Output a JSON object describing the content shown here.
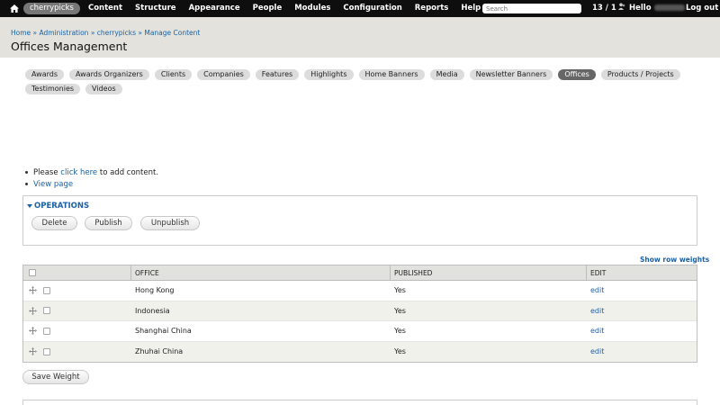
{
  "toolbar": {
    "items": [
      "cherrypicks",
      "Content",
      "Structure",
      "Appearance",
      "People",
      "Modules",
      "Configuration",
      "Reports",
      "Help"
    ],
    "search_placeholder": "Search",
    "counter": "13 / 1",
    "hello": "Hello",
    "logout": "Log out"
  },
  "header": {
    "breadcrumb": [
      "Home",
      "Administration",
      "cherrypicks",
      "Manage Content"
    ],
    "breadcrumb_sep": "»",
    "title": "Offices Management"
  },
  "tabs": [
    "Awards",
    "Awards Organizers",
    "Clients",
    "Companies",
    "Features",
    "Highlights",
    "Home Banners",
    "Media",
    "Newsletter Banners",
    "Offices",
    "Products / Projects",
    "Testimonies",
    "Videos"
  ],
  "active_tab": "Offices",
  "links": {
    "please_prefix": "Please ",
    "click_here": "click here",
    "please_suffix": " to add content.",
    "view_page": "View page"
  },
  "operations": {
    "legend": "OPERATIONS",
    "delete": "Delete",
    "publish": "Publish",
    "unpublish": "Unpublish"
  },
  "show_row_weights": "Show row weights",
  "table": {
    "headers": {
      "office": "OFFICE",
      "published": "PUBLISHED",
      "edit": "EDIT"
    },
    "rows": [
      {
        "office": "Hong Kong",
        "published": "Yes",
        "edit": "edit"
      },
      {
        "office": "Indonesia",
        "published": "Yes",
        "edit": "edit"
      },
      {
        "office": "Shanghai China",
        "published": "Yes",
        "edit": "edit"
      },
      {
        "office": "Zhuhai China",
        "published": "Yes",
        "edit": "edit"
      }
    ]
  },
  "save_weight": "Save Weight",
  "colors": {
    "toolbar": "#0e0e0e",
    "header": "#e3e2dc",
    "link": "#1a62a6",
    "active_tab": "#666666"
  }
}
